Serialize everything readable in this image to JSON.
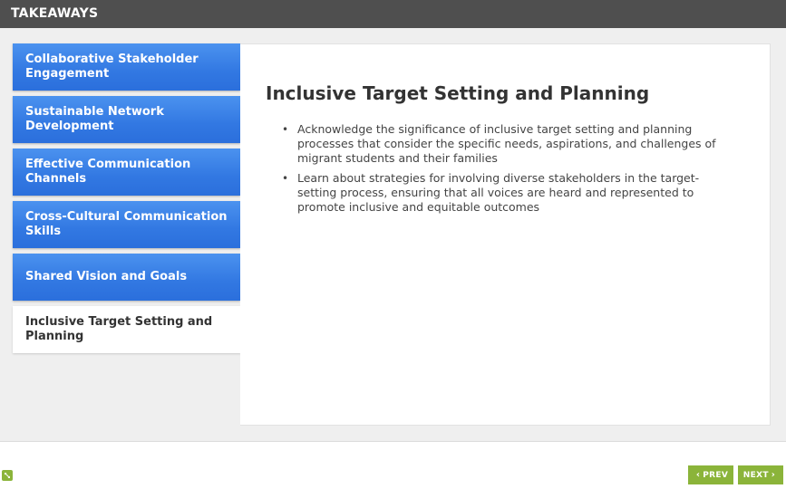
{
  "header": {
    "title": "TAKEAWAYS"
  },
  "tabs": [
    {
      "label": "Collaborative Stakeholder Engagement"
    },
    {
      "label": "Sustainable Network Development"
    },
    {
      "label": "Effective Communication Channels"
    },
    {
      "label": "Cross-Cultural Communication Skills"
    },
    {
      "label": "Shared Vision and Goals"
    },
    {
      "label": "Inclusive Target Setting and Planning"
    }
  ],
  "panel": {
    "title": "Inclusive Target Setting and Planning",
    "bullets": [
      "Acknowledge the significance of inclusive target setting and planning processes that consider the specific needs, aspirations, and challenges of migrant students and their families",
      "Learn about strategies for involving diverse stakeholders in the target-setting process, ensuring that all voices are heard and represented to promote inclusive and equitable outcomes"
    ]
  },
  "nav": {
    "prev_label": "PREV",
    "next_label": "NEXT"
  },
  "colors": {
    "header_bg": "#4f4f4f",
    "tab_blue": "#3278e2",
    "nav_green": "#8bb43a"
  },
  "icons": {
    "resize": "resize-icon",
    "prev": "chevron-left-icon",
    "next": "chevron-right-icon"
  }
}
